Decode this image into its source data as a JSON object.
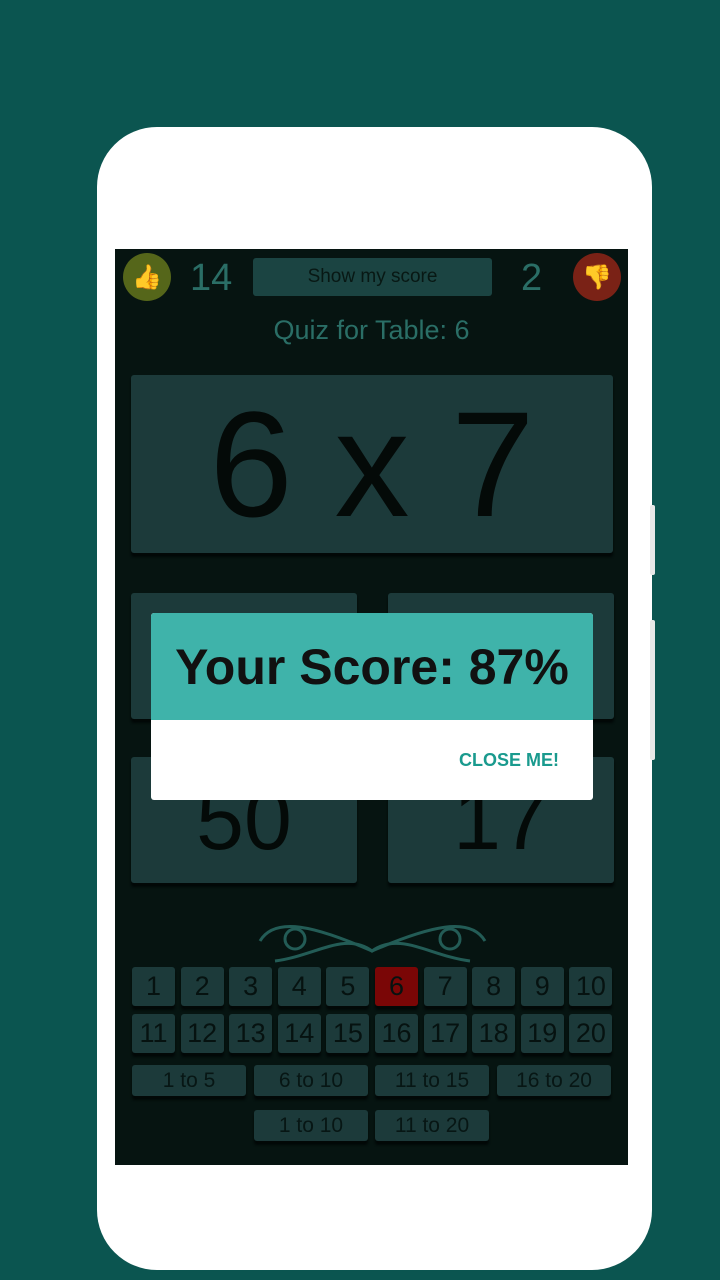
{
  "header": {
    "correct_count": "14",
    "wrong_count": "2",
    "show_score_label": "Show my score",
    "correct_icon": "thumbs-up-icon",
    "wrong_icon": "thumbs-down-icon"
  },
  "quiz": {
    "title": "Quiz for Table: 6",
    "question": "6 x 7",
    "answers": [
      "",
      "",
      "50",
      "17"
    ]
  },
  "tables": {
    "numbers": [
      "1",
      "2",
      "3",
      "4",
      "5",
      "6",
      "7",
      "8",
      "9",
      "10",
      "11",
      "12",
      "13",
      "14",
      "15",
      "16",
      "17",
      "18",
      "19",
      "20"
    ],
    "selected": "6",
    "ranges": [
      "1 to 5",
      "6 to 10",
      "11 to 15",
      "16 to 20"
    ],
    "ranges2": [
      "1 to 10",
      "11 to 20"
    ]
  },
  "dialog": {
    "title": "Your Score: 87%",
    "close_label": "CLOSE ME!"
  },
  "colors": {
    "background": "#0b5550",
    "dialog_header": "#3fb3aa",
    "selected": "#7a0606",
    "accent": "#1a9a8e"
  }
}
